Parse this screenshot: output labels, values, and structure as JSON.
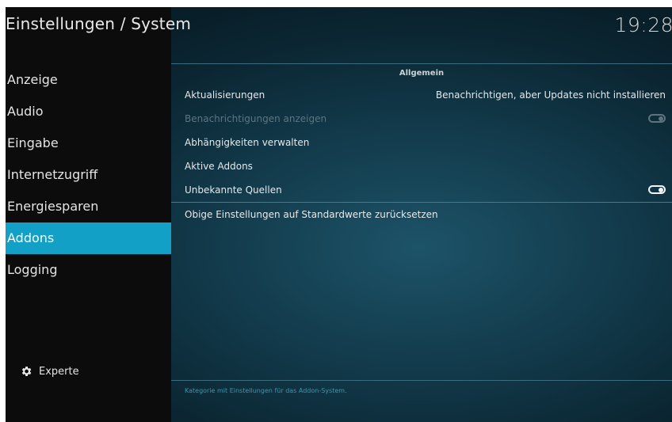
{
  "header": {
    "title": "Einstellungen / System",
    "clock": "19:28"
  },
  "sidebar": {
    "items": [
      {
        "label": "Anzeige"
      },
      {
        "label": "Audio"
      },
      {
        "label": "Eingabe"
      },
      {
        "label": "Internetzugriff"
      },
      {
        "label": "Energiesparen"
      },
      {
        "label": "Addons",
        "selected": true
      },
      {
        "label": "Logging"
      }
    ],
    "level_button": {
      "label": "Experte",
      "icon": "gear-icon"
    }
  },
  "main": {
    "section_title": "Allgemein",
    "settings": [
      {
        "label": "Aktualisierungen",
        "value": "Benachrichtigen, aber Updates nicht installieren"
      },
      {
        "label": "Benachrichtigungen anzeigen",
        "toggle": true,
        "enabled": false
      },
      {
        "label": "Abhängigkeiten verwalten"
      },
      {
        "label": "Aktive Addons"
      },
      {
        "label": "Unbekannte Quellen",
        "toggle": true,
        "enabled": true
      },
      {
        "label": "Obige Einstellungen auf Standardwerte zurücksetzen"
      }
    ],
    "description": "Kategorie mit Einstellungen für das Addon-System."
  },
  "colors": {
    "accent": "#12a0c7",
    "sidebar_bg": "#0c0c0c",
    "content_bg": "#123a4b"
  }
}
